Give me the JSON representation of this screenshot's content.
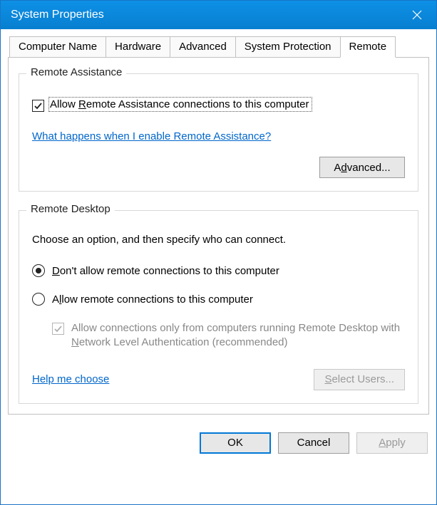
{
  "window": {
    "title": "System Properties"
  },
  "tabs": {
    "computer_name": "Computer Name",
    "hardware": "Hardware",
    "advanced": "Advanced",
    "system_protection": "System Protection",
    "remote": "Remote"
  },
  "remote_assistance": {
    "legend": "Remote Assistance",
    "allow_prefix": "Allow ",
    "allow_underline": "R",
    "allow_suffix": "emote Assistance connections to this computer",
    "help_link": "What happens when I enable Remote Assistance?",
    "advanced_btn_prefix": "A",
    "advanced_btn_underline": "d",
    "advanced_btn_suffix": "vanced..."
  },
  "remote_desktop": {
    "legend": "Remote Desktop",
    "intro": "Choose an option, and then specify who can connect.",
    "opt1_underline": "D",
    "opt1_suffix": "on't allow remote connections to this computer",
    "opt2_prefix": "A",
    "opt2_underline": "l",
    "opt2_suffix": "low remote connections to this computer",
    "nla_prefix": "Allow connections only from computers running Remote Desktop with ",
    "nla_underline": "N",
    "nla_suffix": "etwork Level Authentication (recommended)",
    "help_choose": "Help me choose",
    "select_users_underline": "S",
    "select_users_suffix": "elect Users..."
  },
  "buttons": {
    "ok": "OK",
    "cancel": "Cancel",
    "apply_underline": "A",
    "apply_suffix": "pply"
  }
}
